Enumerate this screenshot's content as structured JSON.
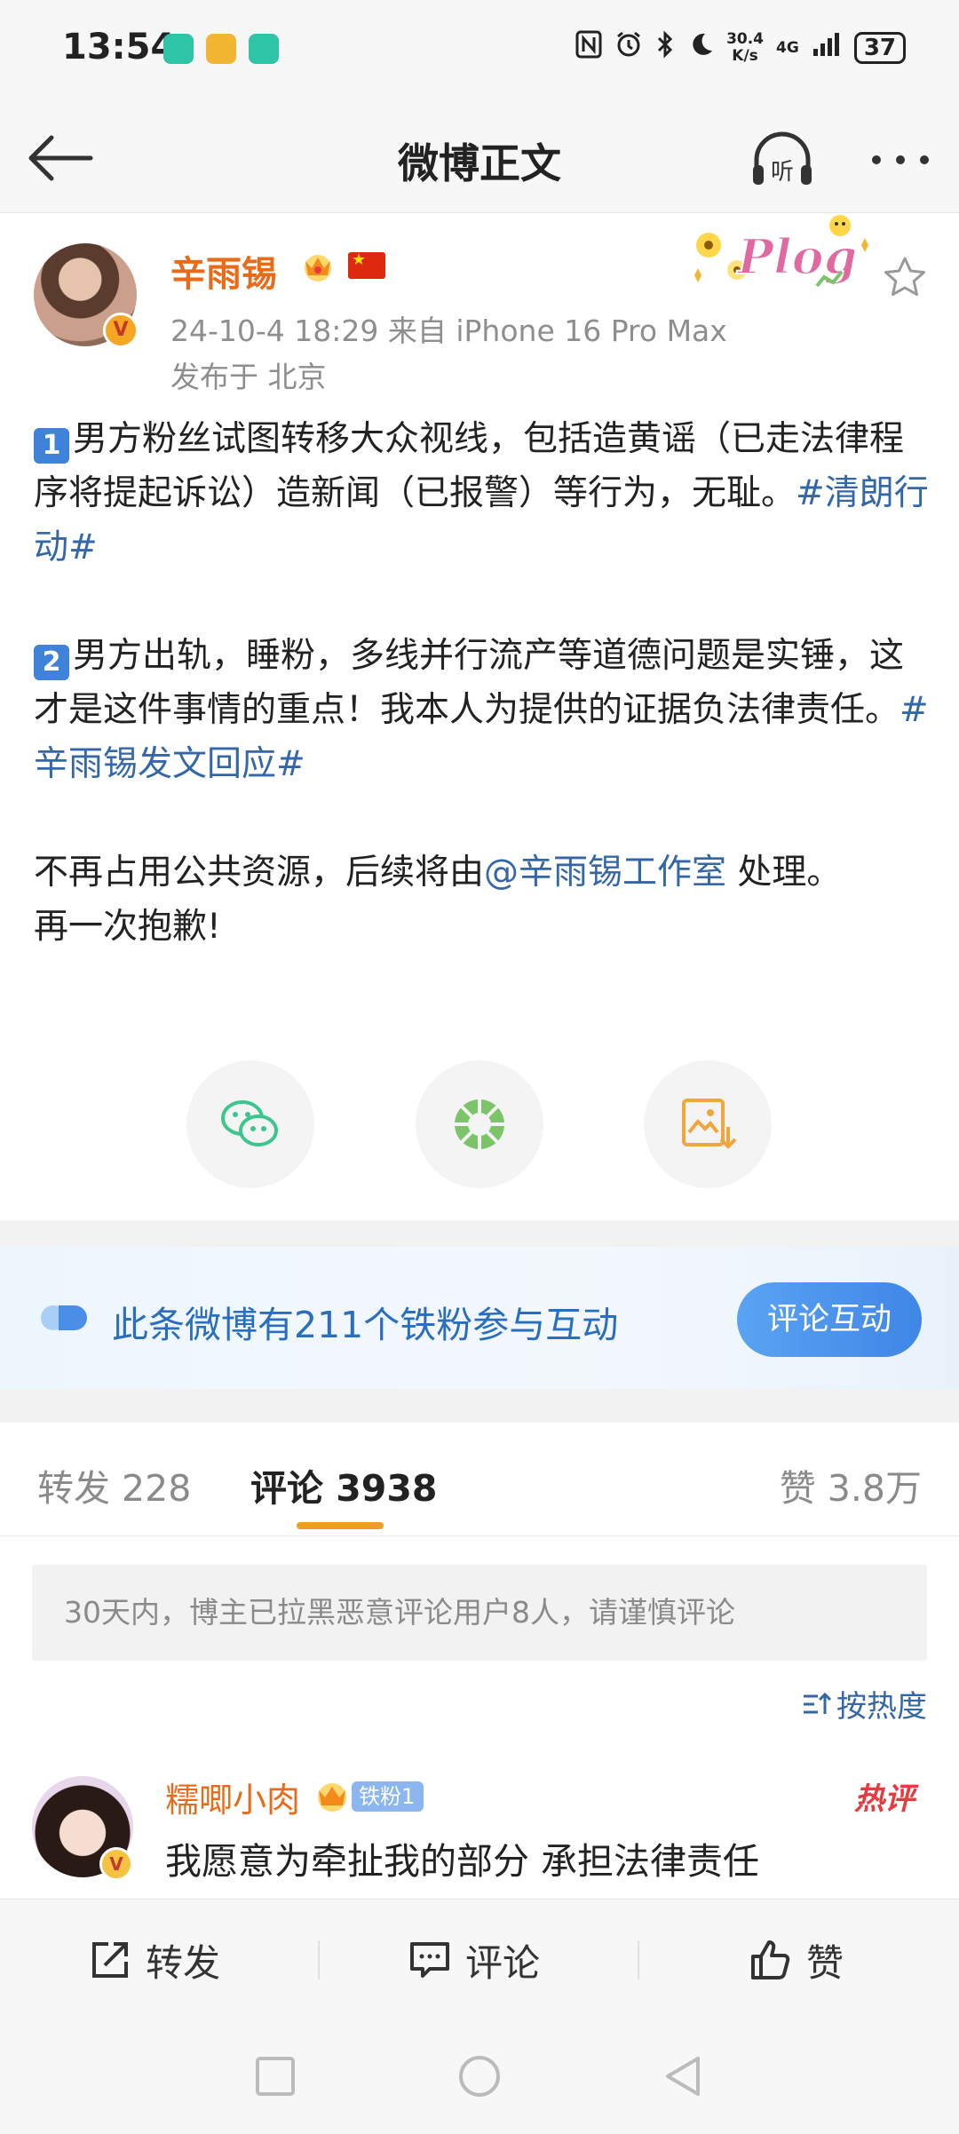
{
  "status_bar": {
    "time": "13:54",
    "net_speed_value": "30.4",
    "net_speed_unit": "K/s",
    "network": "4G",
    "battery": "37"
  },
  "nav": {
    "title": "微博正文",
    "listen_label": "听"
  },
  "post": {
    "author": "辛雨锡",
    "verify_mark": "V",
    "meta": "24-10-4 18:29  来自 iPhone 16 Pro Max",
    "location": "发布于 北京",
    "sticker_text": "Plog",
    "para1_num": "1",
    "para1_text": "男方粉丝试图转移大众视线，包括造黄谣（已走法律程序将提起诉讼）造新闻（已报警）等行为，无耻。",
    "para1_topic": "#清朗行动#",
    "para2_num": "2",
    "para2_text": "男方出轨，睡粉，多线并行流产等道德问题是实锤，这才是这件事情的重点！我本人为提供的证据负法律责任。",
    "para2_topic": "#辛雨锡发文回应#",
    "para3_before": "不再占用公共资源，后续将由",
    "para3_mention": "@辛雨锡工作室",
    "para3_after": " 处理。",
    "para4_text": "再一次抱歉!"
  },
  "share": {
    "icons": [
      "wechat-icon",
      "moments-icon",
      "save-image-icon"
    ]
  },
  "fans_banner": {
    "text": "此条微博有211个铁粉参与互动",
    "button": "评论互动"
  },
  "tabs": {
    "repost": "转发 228",
    "comment": "评论 3938",
    "like": "赞 3.8万"
  },
  "notice": "30天内，博主已拉黑恶意评论用户8人，请谨慎评论",
  "sort": "按热度",
  "comment": {
    "user": "糯唧小肉",
    "fan_badge": "铁粉1",
    "hot_tag": "热评",
    "text": "我愿意为牵扯我的部分 承担法律责任",
    "verify_mark": "V"
  },
  "actions": {
    "repost": "转发",
    "comment": "评论",
    "like": "赞"
  },
  "colors": {
    "accent_orange": "#e86b1a",
    "link_blue": "#3467a8",
    "tab_underline": "#f59a23",
    "button_blue": "#3f86e6"
  }
}
